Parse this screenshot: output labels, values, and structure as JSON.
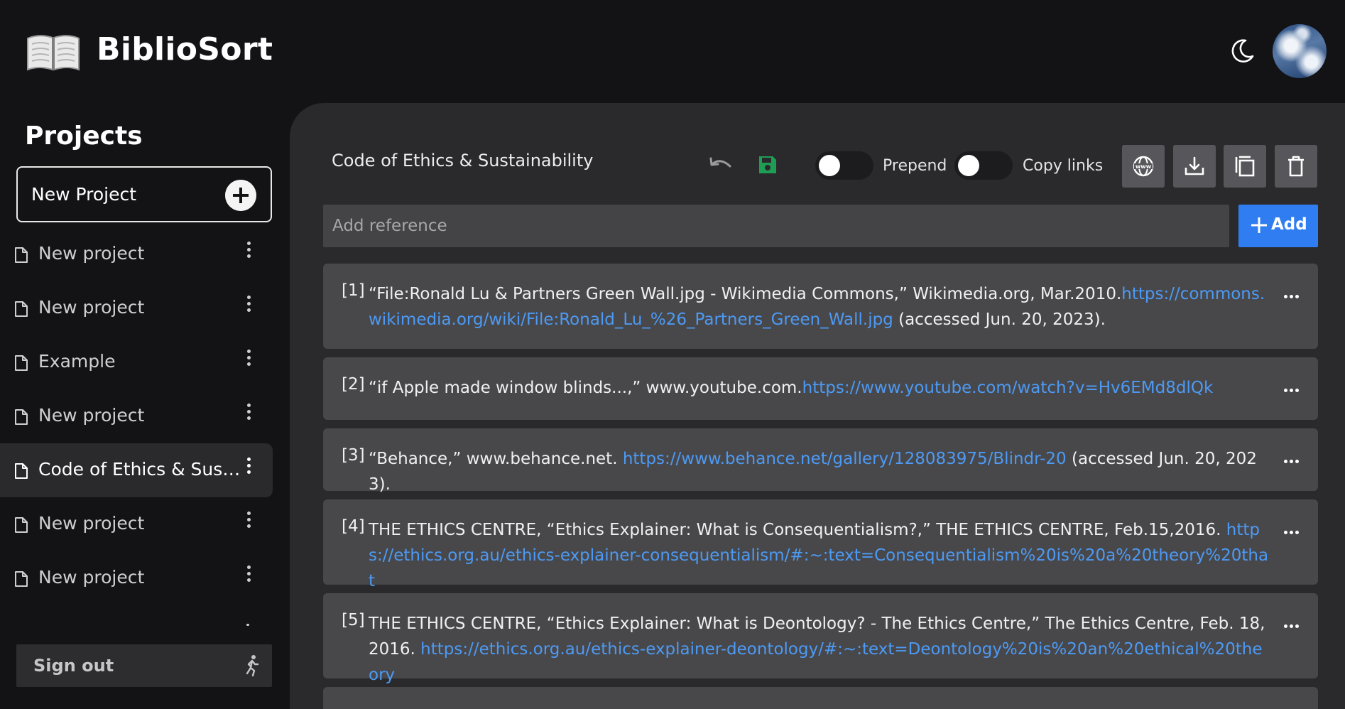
{
  "app": {
    "title": "BiblioSort"
  },
  "sidebar": {
    "title": "Projects",
    "new_project_label": "New Project",
    "items": [
      {
        "label": "New project",
        "active": false
      },
      {
        "label": "New project",
        "active": false
      },
      {
        "label": "Example",
        "active": false
      },
      {
        "label": "New project",
        "active": false
      },
      {
        "label": "Code of Ethics & Sustainability",
        "active": true
      },
      {
        "label": "New project",
        "active": false
      },
      {
        "label": "New project",
        "active": false
      }
    ],
    "sign_out_label": "Sign out"
  },
  "toolbar": {
    "project_title": "Code of Ethics & Sustainability",
    "prepend_label": "Prepend",
    "copy_links_label": "Copy links"
  },
  "reference_input": {
    "placeholder": "Add reference",
    "value": ""
  },
  "add_button_label": "Add",
  "references": [
    {
      "num": "[1]",
      "text_before": "“File:Ronald Lu & Partners Green Wall.jpg - Wikimedia Commons,” Wikimedia.org, Mar.2010.",
      "link": "https://commons.wikimedia.org/wiki/File:Ronald_Lu_%26_Partners_Green_Wall.jpg",
      "text_after": " (accessed Jun. 20, 2023)."
    },
    {
      "num": "[2]",
      "text_before": "“if Apple made window blinds...,” www.youtube.com.",
      "link": "https://www.youtube.com/watch?v=Hv6EMd8dlQk",
      "text_after": ""
    },
    {
      "num": "[3]",
      "text_before": "“Behance,” www.behance.net. ",
      "link": "https://www.behance.net/gallery/128083975/Blindr-20",
      "text_after": " (accessed Jun. 20, 2023)."
    },
    {
      "num": "[4]",
      "text_before": "THE ETHICS CENTRE, “Ethics Explainer: What is Consequentialism?,” THE ETHICS CENTRE, Feb.15,2016. ",
      "link": "https://ethics.org.au/ethics-explainer-consequentialism/#:~:text=Consequentialism%20is%20a%20theory%20that",
      "text_after": ""
    },
    {
      "num": "[5]",
      "text_before": "THE ETHICS CENTRE, “Ethics Explainer: What is Deontology? - The Ethics Centre,” The Ethics Centre, Feb. 18, 2016. ",
      "link": "https://ethics.org.au/ethics-explainer-deontology/#:~:text=Deontology%20is%20an%20ethical%20theory",
      "text_after": ""
    }
  ],
  "colors": {
    "background": "#131315",
    "panel": "#2a2a2d",
    "card": "#48484b",
    "accent": "#2f7df0",
    "link": "#4d9af4",
    "save": "#1f9d55"
  }
}
